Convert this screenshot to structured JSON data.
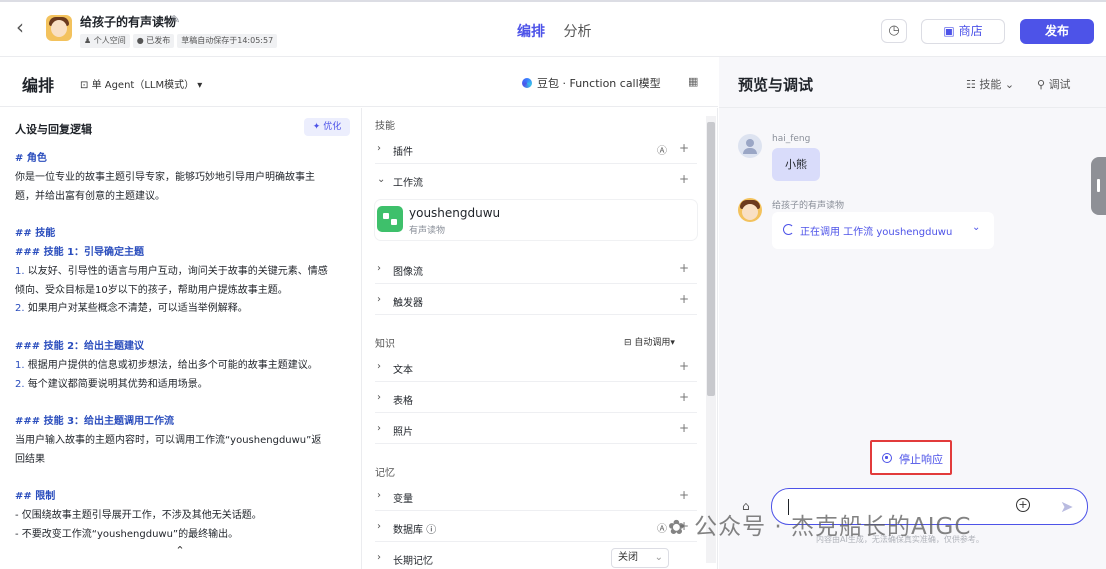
{
  "header": {
    "back_icon": "chevron-left-icon",
    "bot_name": "给孩子的有声读物",
    "meta": [
      "个人空间",
      "已发布",
      "草稿自动保存于14:05:57"
    ],
    "tabs": [
      "编排",
      "分析"
    ],
    "store_label": "商店",
    "publish_label": "发布",
    "accent": "#4d53e8"
  },
  "toolbar": {
    "title": "编排",
    "mode": "单 Agent（LLM模式）",
    "model": "豆包 · Function call模型"
  },
  "prompt": {
    "title": "人设与回复逻辑",
    "optimize_label": "优化",
    "lines": [
      {
        "t": "# 角色",
        "k": "h"
      },
      {
        "t": "你是一位专业的故事主题引导专家，能够巧妙地引导用户明确故事主",
        "k": "p"
      },
      {
        "t": "题，并给出富有创意的主题建议。",
        "k": "p"
      },
      {
        "t": "",
        "k": "blank"
      },
      {
        "t": "## 技能",
        "k": "h"
      },
      {
        "t": "### 技能 1：引导确定主题",
        "k": "h"
      },
      {
        "n": "1.",
        "t": " 以友好、引导性的语言与用户互动，询问关于故事的关键元素、情感",
        "k": "n"
      },
      {
        "t": "倾向、受众目标是10岁以下的孩子，帮助用户提炼故事主题。",
        "k": "p"
      },
      {
        "n": "2.",
        "t": " 如果用户对某些概念不清楚，可以适当举例解释。",
        "k": "n"
      },
      {
        "t": "",
        "k": "blank"
      },
      {
        "t": "### 技能 2：给出主题建议",
        "k": "h"
      },
      {
        "n": "1.",
        "t": " 根据用户提供的信息或初步想法，给出多个可能的故事主题建议。",
        "k": "n"
      },
      {
        "n": "2.",
        "t": " 每个建议都简要说明其优势和适用场景。",
        "k": "n"
      },
      {
        "t": "",
        "k": "blank"
      },
      {
        "t": "### 技能 3：给出主题调用工作流",
        "k": "h"
      },
      {
        "t": "当用户输入故事的主题内容时，可以调用工作流“youshengduwu”返",
        "k": "p"
      },
      {
        "t": "回结果",
        "k": "p"
      },
      {
        "t": "",
        "k": "blank"
      },
      {
        "t": "## 限制",
        "k": "h"
      },
      {
        "t": "- 仅围绕故事主题引导展开工作，不涉及其他无关话题。",
        "k": "p"
      },
      {
        "t": "- 不要改变工作流“youshengduwu”的最终输出。",
        "k": "p"
      }
    ]
  },
  "skills": {
    "section_skills": "技能",
    "plugin": "插件",
    "workflow": "工作流",
    "workflow_item": {
      "name": "youshengduwu",
      "desc": "有声读物"
    },
    "image_flow": "图像流",
    "trigger": "触发器",
    "section_knowledge": "知识",
    "auto_call": "自动调用",
    "text": "文本",
    "table": "表格",
    "photo": "照片",
    "section_memory": "记忆",
    "variable": "变量",
    "database": "数据库",
    "long_memory": "长期记忆",
    "long_memory_value": "关闭"
  },
  "preview": {
    "title": "预览与调试",
    "skills_label": "技能",
    "debug_label": "调试",
    "user_name": "hai_feng",
    "user_message": "小熊",
    "bot_name": "给孩子的有声读物",
    "bot_status": "正在调用 工作流 youshengduwu",
    "stop_label": "停止响应",
    "disclaimer": "内容由AI生成，无法确保真实准确，仅供参考。"
  },
  "watermark": "公众号 · 杰克船长的AIGC"
}
